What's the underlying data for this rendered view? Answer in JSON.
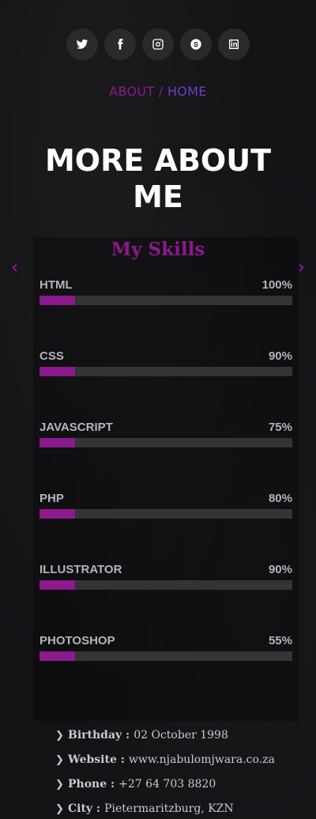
{
  "social": [
    {
      "name": "twitter-icon"
    },
    {
      "name": "facebook-icon"
    },
    {
      "name": "instagram-icon"
    },
    {
      "name": "skype-icon"
    },
    {
      "name": "linkedin-icon"
    }
  ],
  "breadcrumb": {
    "current": "ABOUT",
    "separator": " / ",
    "home": "HOME"
  },
  "page_title": "MORE ABOUT ME",
  "skills_section": {
    "title": "My Skills",
    "prev": "‹",
    "next": "›",
    "skills": [
      {
        "name": "HTML",
        "percent_label": "100%",
        "bar_fill": 0.14
      },
      {
        "name": "CSS",
        "percent_label": "90%",
        "bar_fill": 0.14
      },
      {
        "name": "JAVASCRIPT",
        "percent_label": "75%",
        "bar_fill": 0.14
      },
      {
        "name": "PHP",
        "percent_label": "80%",
        "bar_fill": 0.14
      },
      {
        "name": "ILLUSTRATOR",
        "percent_label": "90%",
        "bar_fill": 0.14
      },
      {
        "name": "PHOTOSHOP",
        "percent_label": "55%",
        "bar_fill": 0.14
      }
    ]
  },
  "info": [
    {
      "label": "Birthday :",
      "value": "02 October 1998"
    },
    {
      "label": "Website :",
      "value": "www.njabulomjwara.co.za"
    },
    {
      "label": "Phone :",
      "value": "+27 64 703 8820"
    },
    {
      "label": "City :",
      "value": "Pietermaritzburg, KZN"
    }
  ],
  "colors": {
    "accent": "#8b1a8c",
    "home_link": "#6c3fc8",
    "background": "#131215",
    "track": "#343336"
  }
}
